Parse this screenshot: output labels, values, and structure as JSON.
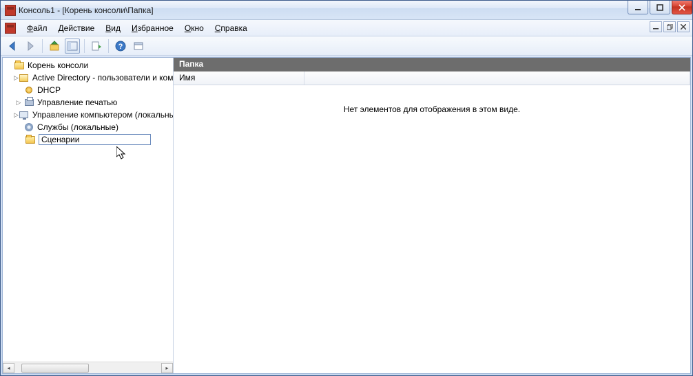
{
  "window": {
    "title": "Консоль1 - [Корень консоли\\Папка]"
  },
  "menu": {
    "file": "Файл",
    "action": "Действие",
    "view": "Вид",
    "favorites": "Избранное",
    "window": "Окно",
    "help": "Справка"
  },
  "tree": {
    "root": "Корень консоли",
    "items": [
      {
        "label": "Active Directory - пользователи и компьютеры",
        "expandable": true
      },
      {
        "label": "DHCP",
        "expandable": false
      },
      {
        "label": "Управление печатью",
        "expandable": true
      },
      {
        "label": "Управление компьютером (локальный)",
        "expandable": true
      },
      {
        "label": "Службы (локальные)",
        "expandable": false
      }
    ]
  },
  "editing": {
    "value": "Сценарии"
  },
  "right": {
    "header": "Папка",
    "column": "Имя",
    "empty": "Нет элементов для отображения в этом виде."
  },
  "icons": {
    "back": "←",
    "forward": "→"
  }
}
